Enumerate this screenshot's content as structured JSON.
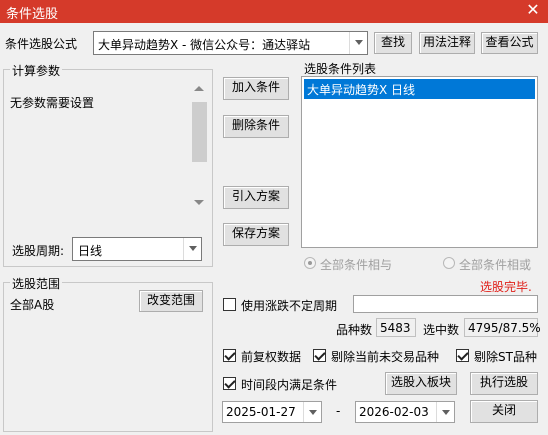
{
  "window": {
    "title": "条件选股",
    "close_glyph": "✕"
  },
  "formula": {
    "label": "条件选股公式",
    "value": "大单异动趋势X  -  微信公众号：通达驿站",
    "find_button": "查找",
    "usage_button": "用法注释",
    "view_button": "查看公式"
  },
  "params": {
    "group_title": "计算参数",
    "text": "无参数需要设置",
    "period_label": "选股周期:",
    "period_value": "日线"
  },
  "actions": {
    "add_condition": "加入条件",
    "delete_condition": "删除条件",
    "import_plan": "引入方案",
    "save_plan": "保存方案"
  },
  "conditions": {
    "label": "选股条件列表",
    "items": [
      "大单异动趋势X  日线"
    ],
    "all_and": "全部条件相与",
    "all_or": "全部条件相或"
  },
  "status": {
    "text": "选股完毕.",
    "color": "#e0201a"
  },
  "range": {
    "group_title": "选股范围",
    "value": "全部A股",
    "change_button": "改变范围"
  },
  "irregular": {
    "label": "使用涨跌不定周期",
    "checked": false,
    "value": ""
  },
  "stats": {
    "count_label": "品种数",
    "count_value": "5483",
    "selected_label": "选中数",
    "selected_value": "4795/87.5%"
  },
  "options": {
    "adjust": {
      "label": "前复权数据",
      "checked": true
    },
    "exclude_untraded": {
      "label": "剔除当前未交易品种",
      "checked": true
    },
    "exclude_st": {
      "label": "剔除ST品种",
      "checked": true
    },
    "period_all": {
      "label": "时间段内满足条件",
      "checked": true
    }
  },
  "bottom": {
    "to_block_button": "选股入板块",
    "run_button": "执行选股",
    "close_button": "关闭",
    "date_from": "2025-01-27",
    "date_sep": "-",
    "date_to": "2026-02-03"
  },
  "colors": {
    "titlebar": "#d53a2a",
    "selection": "#0078d7"
  }
}
